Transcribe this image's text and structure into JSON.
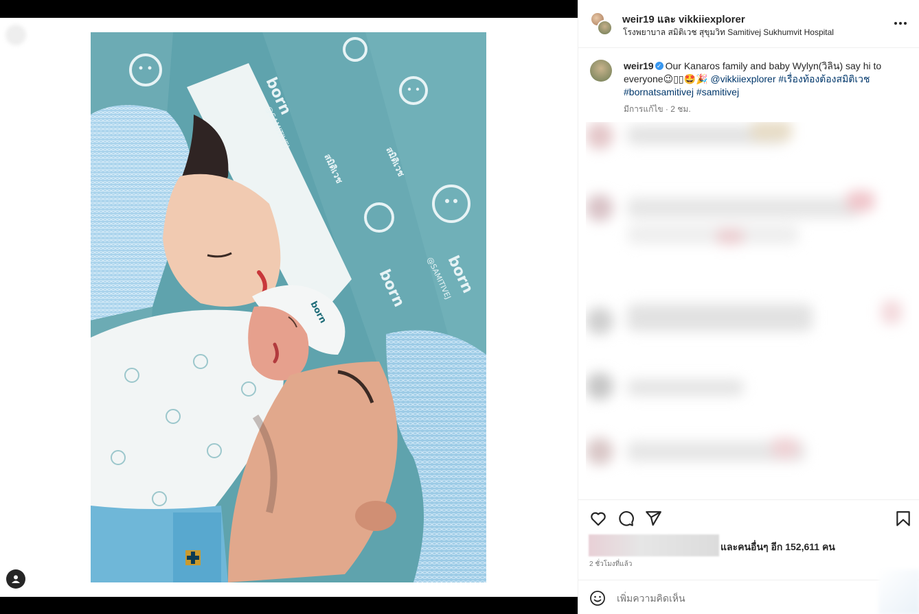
{
  "media": {
    "photo_alt": "",
    "printed_text": {
      "born": "born",
      "handle": "@SAMITIVEJ",
      "brand_thai": "สมิติเวช"
    }
  },
  "post": {
    "header_names": "weir19 และ vikkiiexplorer",
    "location": "โรงพยาบาล สมิติเวช สุขุมวิท Samitivej Sukhumvit Hospital",
    "more_icon": "more-options-icon"
  },
  "caption": {
    "username": "weir19",
    "text_1": "Our Kanaros family and baby Wylyn(วิลิน) say hi to everyone",
    "emojis": "😉▯▯🤩🎉",
    "mention": "@vikkiiexplorer",
    "tag_1": "#เรื่องท้องต้องสมิติเวช",
    "tag_2": "#bornatsamitivej",
    "tag_3": "#samitivej",
    "meta": "มีการแก้ไข · 2 ชม."
  },
  "likes": {
    "text": "และคนอื่นๆ อีก 152,611 คน"
  },
  "time_ago": "2 ชั่วโมงที่แล้ว",
  "comment": {
    "placeholder": "เพิ่มความคิดเห็น"
  },
  "colors": {
    "link": "#00376b",
    "verified": "#3897f0",
    "drape": "#5fa3ad",
    "cap": "#a9d3ec"
  }
}
